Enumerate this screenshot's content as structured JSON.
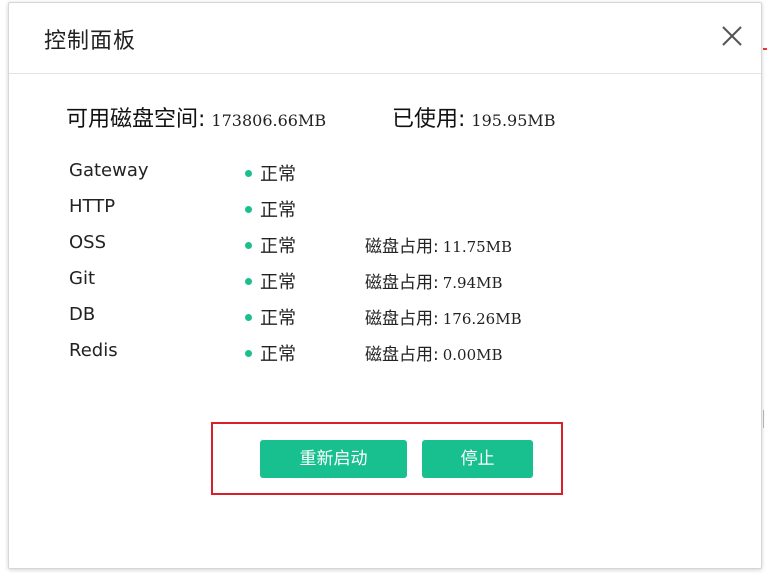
{
  "dialog": {
    "title": "控制面板",
    "close_icon": "close-icon"
  },
  "disk": {
    "available_label": "可用磁盘空间:",
    "available_value": "173806.66MB",
    "used_label": "已使用:",
    "used_value": "195.95MB"
  },
  "services": [
    {
      "name": "Gateway",
      "status": "正常",
      "disk_label": "",
      "disk_value": ""
    },
    {
      "name": "HTTP",
      "status": "正常",
      "disk_label": "",
      "disk_value": ""
    },
    {
      "name": "OSS",
      "status": "正常",
      "disk_label": "磁盘占用:",
      "disk_value": "11.75MB"
    },
    {
      "name": "Git",
      "status": "正常",
      "disk_label": "磁盘占用:",
      "disk_value": "7.94MB"
    },
    {
      "name": "DB",
      "status": "正常",
      "disk_label": "磁盘占用:",
      "disk_value": "176.26MB"
    },
    {
      "name": "Redis",
      "status": "正常",
      "disk_label": "磁盘占用:",
      "disk_value": "0.00MB"
    }
  ],
  "actions": {
    "restart_label": "重新启动",
    "stop_label": "停止"
  },
  "colors": {
    "accent": "#19c08f",
    "status_ok": "#1bbf8d",
    "highlight_border": "#d8202a"
  }
}
